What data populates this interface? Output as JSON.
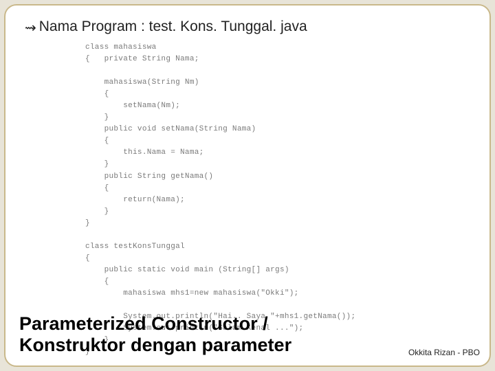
{
  "header": {
    "bullet": "⇝",
    "text": "Nama Program : test. Kons. Tunggal. java"
  },
  "code": {
    "lines": [
      "class mahasiswa",
      "{   private String Nama;",
      "",
      "    mahasiswa(String Nm)",
      "    {",
      "        setNama(Nm);",
      "    }",
      "    public void setNama(String Nama)",
      "    {",
      "        this.Nama = Nama;",
      "    }",
      "    public String getNama()",
      "    {",
      "        return(Nama);",
      "    }",
      "}",
      "",
      "class testKonsTunggal",
      "{",
      "    public static void main (String[] args)",
      "    {",
      "        mahasiswa mhs1=new mahasiswa(\"Okki\");",
      "",
      "        System.out.println(\"Hai.. Saya \"+mhs1.getNama());",
      "        System.out.println(\"Salam Kenal ...\");",
      "    }",
      "}"
    ]
  },
  "footer": {
    "title_line1": "Parameterized Constructor /",
    "title_line2": "Konstruktor dengan parameter",
    "author": "Okkita Rizan - PBO"
  }
}
